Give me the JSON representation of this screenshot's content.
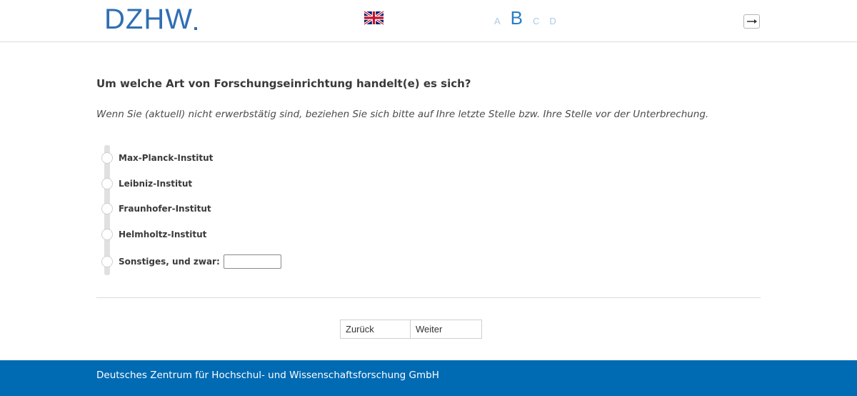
{
  "header": {
    "logo_text": "DZHW",
    "language_flag_icon": "uk-flag-icon",
    "sections": [
      "A",
      "B",
      "C",
      "D"
    ],
    "active_section": "B",
    "exit_icon": "exit-arrow-icon"
  },
  "question": {
    "title": "Um welche Art von Forschungseinrichtung handelt(e) es sich?",
    "instruction": "Wenn Sie (aktuell) nicht erwerbstätig sind, beziehen Sie sich bitte auf Ihre letzte Stelle bzw. Ihre Stelle vor der Unterbrechung."
  },
  "options": [
    {
      "label": "Max-Planck-Institut"
    },
    {
      "label": "Leibniz-Institut"
    },
    {
      "label": "Fraunhofer-Institut"
    },
    {
      "label": "Helmholtz-Institut"
    },
    {
      "label": "Sonstiges, und zwar:"
    }
  ],
  "other_input": {
    "value": "",
    "placeholder": ""
  },
  "navigation": {
    "back_label": "Zurück",
    "next_label": "Weiter"
  },
  "footer": {
    "text": "Deutsches Zentrum für Hochschul- und Wissenschaftsforschung GmbH"
  },
  "colors": {
    "brand_blue": "#2f6fb3",
    "footer_blue": "#006ab3",
    "section_inactive": "#a9cbe8",
    "section_active": "#2a7ec4"
  }
}
